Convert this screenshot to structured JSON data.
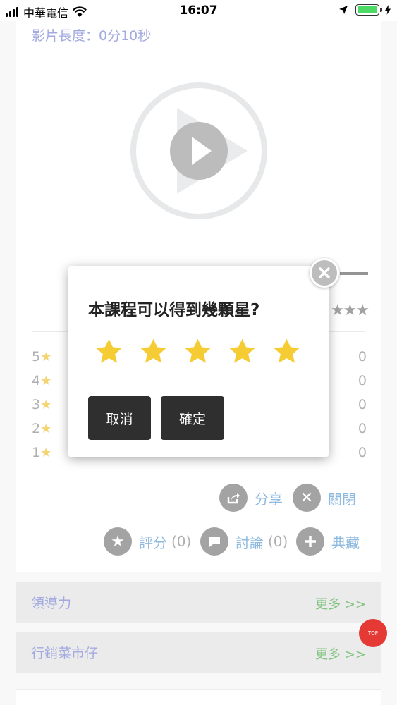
{
  "status_bar": {
    "carrier": "中華電信",
    "time": "16:07"
  },
  "video": {
    "length_label": "影片長度：0分10秒"
  },
  "ratings": [
    {
      "level": "5",
      "count": "0"
    },
    {
      "level": "4",
      "count": "0"
    },
    {
      "level": "3",
      "count": "0"
    },
    {
      "level": "2",
      "count": "0"
    },
    {
      "level": "1",
      "count": "0"
    }
  ],
  "actions": {
    "share": "分享",
    "close": "關閉",
    "rate": "評分",
    "rate_count": "(0)",
    "discuss": "討論",
    "discuss_count": "(0)",
    "collect": "典藏"
  },
  "sections": [
    {
      "name": "領導力",
      "more": "更多 >>"
    },
    {
      "name": "行銷菜市仔",
      "more": "更多 >>"
    }
  ],
  "top_button": "TOP",
  "modal": {
    "title": "本課程可以得到幾顆星?",
    "cancel": "取消",
    "confirm": "確定",
    "star_count": 5
  },
  "colors": {
    "star": "#f5cc33",
    "link_blue": "#6fa7d6",
    "more_green": "#5fb35f",
    "heading_purple": "#8a93d8",
    "top_red": "#e53935"
  }
}
